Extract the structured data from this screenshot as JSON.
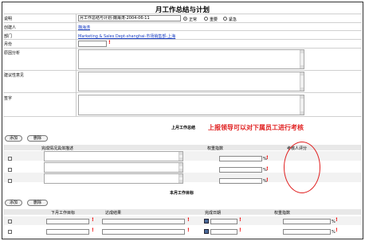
{
  "page": {
    "title": "月工作总结与计划"
  },
  "form": {
    "desc_label": "说明",
    "desc_value": "月工作总结与计划-魏海涛-2004-06-11",
    "priority_options": [
      "正常",
      "重要",
      "紧急"
    ],
    "creator_label": "创建人",
    "creator_value": "魏海涛",
    "dept_label": "部门",
    "dept_value": "Marketing & Sales Dept-shanghai-市场销售部-上海",
    "month_label": "月份",
    "month_value": "",
    "reason_label": "原因分析",
    "advice_label": "建议性意见",
    "sign_label": "签字"
  },
  "summary": {
    "title": "上月工作总结",
    "add": "添加",
    "delete": "删除",
    "headers": [
      "完成情况具体描述",
      "权重指数",
      "考核人评分"
    ],
    "rows": 3,
    "pct": "%"
  },
  "plan": {
    "title": "本月工作目标",
    "add": "添加",
    "delete": "删除",
    "headers": [
      "下月工作目标",
      "达成结果",
      "完成日期",
      "权重指数"
    ],
    "rows": 2,
    "pct": "%"
  },
  "annotation": {
    "text": "上报领导可以对下属员工进行考核",
    "color": "#e02020"
  }
}
